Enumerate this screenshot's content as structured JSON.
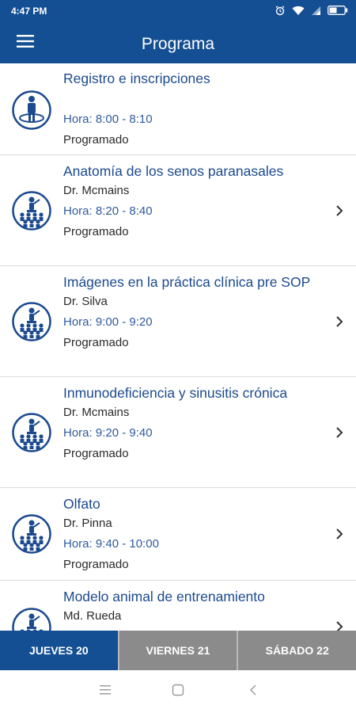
{
  "status_bar": {
    "time": "4:47 PM",
    "icons": [
      "alarm-icon",
      "wifi-icon",
      "signal-icon",
      "battery-icon"
    ]
  },
  "header": {
    "title": "Programa",
    "menu_icon": "hamburger-menu-icon"
  },
  "sessions": [
    {
      "title": "Registro e inscripciones",
      "speaker": "",
      "time": "Hora: 8:00 - 8:10",
      "status": "Programado",
      "icon": "registration-icon",
      "has_chevron": false
    },
    {
      "title": "Anatomía de los senos paranasales",
      "speaker": "Dr. Mcmains",
      "time": "Hora: 8:20 - 8:40",
      "status": "Programado",
      "icon": "lecture-icon",
      "has_chevron": true
    },
    {
      "title": "Imágenes en la práctica clínica pre SOP",
      "speaker": "Dr. Silva",
      "time": "Hora: 9:00 - 9:20",
      "status": "Programado",
      "icon": "lecture-icon",
      "has_chevron": true
    },
    {
      "title": "Inmunodeficiencia y sinusitis crónica",
      "speaker": "Dr. Mcmains",
      "time": "Hora: 9:20 - 9:40",
      "status": "Programado",
      "icon": "lecture-icon",
      "has_chevron": true
    },
    {
      "title": "Olfato",
      "speaker": "Dr. Pinna",
      "time": "Hora: 9:40 - 10:00",
      "status": "Programado",
      "icon": "lecture-icon",
      "has_chevron": true
    },
    {
      "title": "Modelo animal de entrenamiento",
      "speaker": "Md. Rueda",
      "time": "",
      "status": "",
      "icon": "lecture-icon",
      "has_chevron": true
    }
  ],
  "day_tabs": [
    {
      "label": "JUEVES 20",
      "active": true
    },
    {
      "label": "VIERNES 21",
      "active": false
    },
    {
      "label": "SÁBADO 22",
      "active": false
    }
  ],
  "nav_bar": {
    "buttons": [
      "recents-icon",
      "home-icon",
      "back-icon"
    ]
  },
  "colors": {
    "primary": "#144f93",
    "title_text": "#1c4a8f",
    "time_text": "#2f5a9e",
    "inactive_tab": "#8b8b8b"
  }
}
